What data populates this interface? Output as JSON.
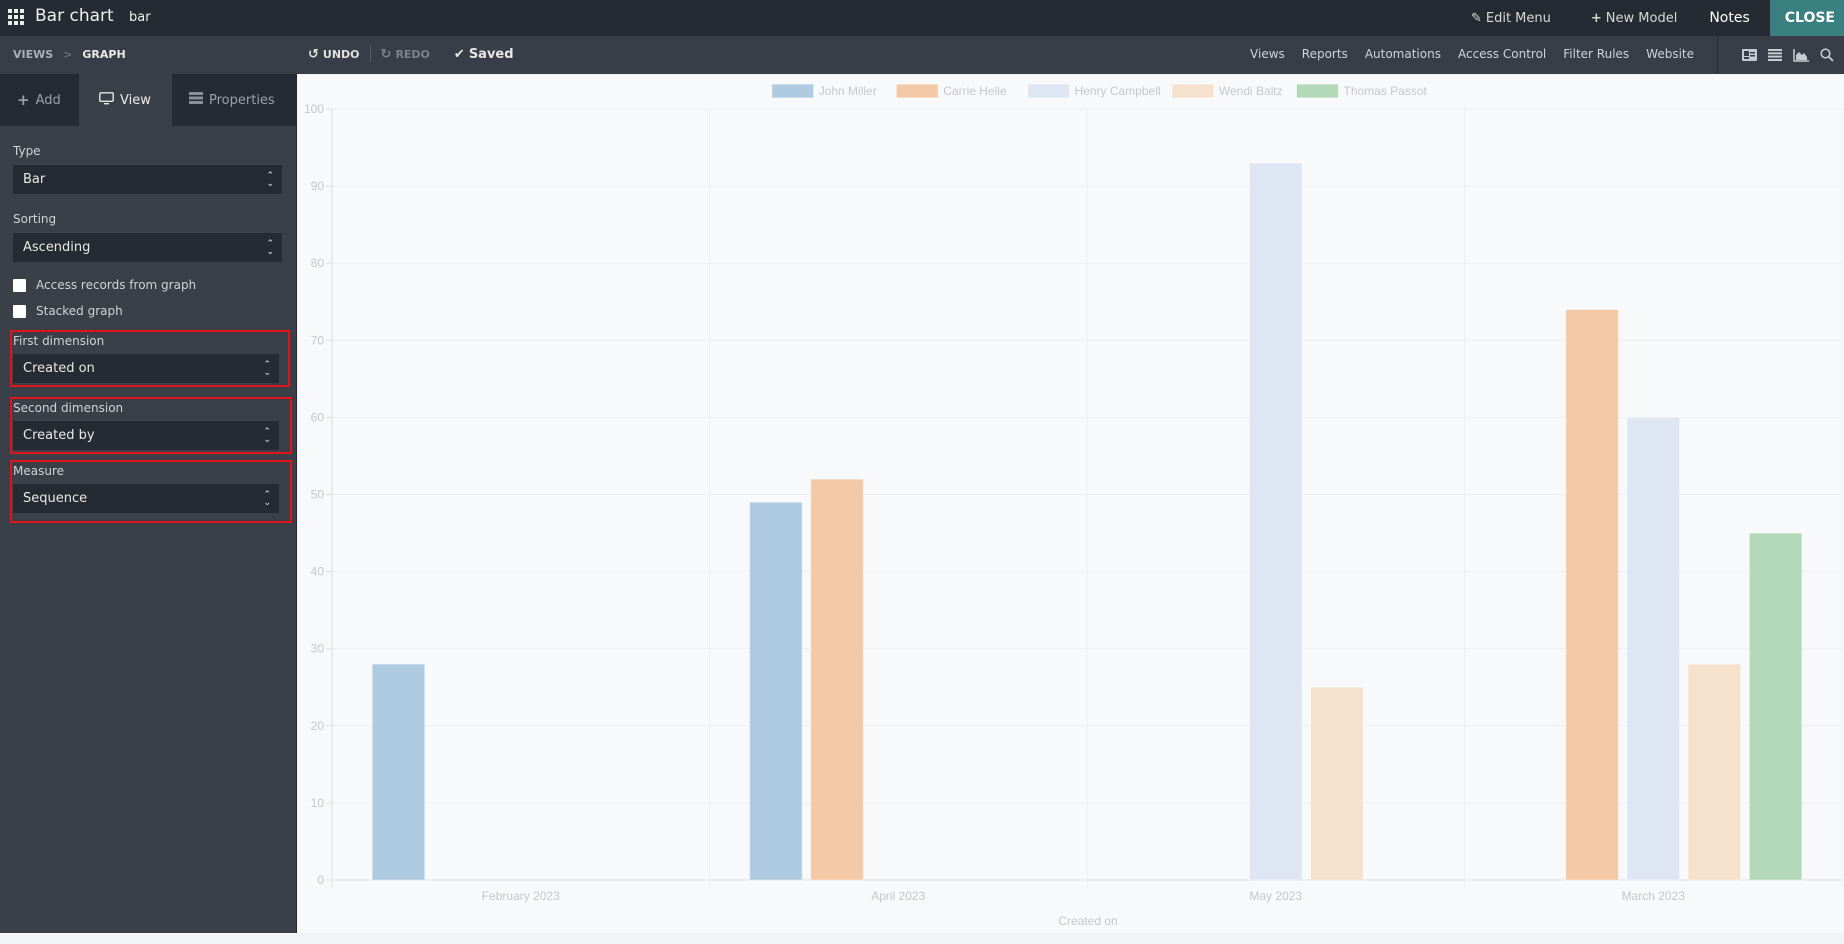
{
  "topbar": {
    "title": "Bar chart",
    "subtitle": "bar",
    "edit_menu": "Edit Menu",
    "new_model": "New Model",
    "notes": "Notes",
    "close": "CLOSE"
  },
  "subbar": {
    "breadcrumb": [
      "VIEWS",
      "GRAPH"
    ],
    "undo": "UNDO",
    "redo": "REDO",
    "saved": "Saved",
    "links": [
      "Views",
      "Reports",
      "Automations",
      "Access Control",
      "Filter Rules",
      "Website"
    ],
    "icons": [
      "form-view-icon",
      "list-view-icon",
      "graph-view-icon",
      "search-icon"
    ]
  },
  "sidebar": {
    "tabs": [
      {
        "label": "Add",
        "icon": "plus-icon"
      },
      {
        "label": "View",
        "icon": "monitor-icon"
      },
      {
        "label": "Properties",
        "icon": "properties-icon"
      }
    ],
    "active_tab": "View",
    "type": {
      "label": "Type",
      "value": "Bar"
    },
    "sorting": {
      "label": "Sorting",
      "value": "Ascending"
    },
    "access_records": {
      "label": "Access records from graph",
      "checked": false
    },
    "stacked": {
      "label": "Stacked graph",
      "checked": false
    },
    "first_dimension": {
      "label": "First dimension",
      "value": "Created on"
    },
    "second_dimension": {
      "label": "Second dimension",
      "value": "Created by"
    },
    "measure": {
      "label": "Measure",
      "value": "Sequence"
    }
  },
  "chart_data": {
    "type": "bar",
    "title": "",
    "xlabel": "Created on",
    "ylabel": "",
    "ylim": [
      0,
      100
    ],
    "yticks": [
      0,
      10,
      20,
      30,
      40,
      50,
      60,
      70,
      80,
      90,
      100
    ],
    "grid": true,
    "legend_position": "top-center",
    "categories": [
      "February 2023",
      "April 2023",
      "May 2023",
      "March 2023"
    ],
    "series": [
      {
        "name": "John Miller",
        "color": "#aecbe2",
        "values": [
          28,
          49,
          0,
          0
        ]
      },
      {
        "name": "Carrie Helle",
        "color": "#f4c9a8",
        "values": [
          0,
          52,
          0,
          74
        ]
      },
      {
        "name": "Henry Campbell",
        "color": "#dfe6f3",
        "values": [
          0,
          0,
          93,
          60
        ]
      },
      {
        "name": "Wendi Baltz",
        "color": "#f6e1cc",
        "values": [
          0,
          0,
          25,
          28
        ]
      },
      {
        "name": "Thomas Passot",
        "color": "#b4d9b8",
        "values": [
          0,
          0,
          0,
          45
        ]
      }
    ]
  }
}
